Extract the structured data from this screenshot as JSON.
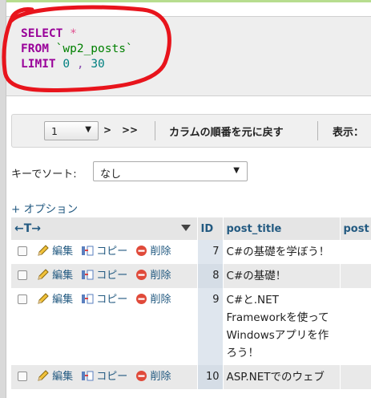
{
  "sql": {
    "line1": {
      "keyword": "SELECT",
      "rest": "*"
    },
    "line2": {
      "keyword": "FROM",
      "rest": "`wp2_posts`"
    },
    "line3": {
      "keyword": "LIMIT",
      "offset": "0",
      "comma": ",",
      "count": "30"
    }
  },
  "nav": {
    "page_value": "1",
    "next_label": ">",
    "last_label": ">>",
    "reset_columns_label": "カラムの順番を元に戻す",
    "display_label": "表示："
  },
  "sort": {
    "label": "キーでソート:",
    "selected": "なし"
  },
  "options_link": "+ オプション",
  "table": {
    "headers": {
      "arrows": "←T→",
      "id": "ID",
      "title": "post_title",
      "next": "post"
    },
    "actions": {
      "edit": "編集",
      "copy": "コピー",
      "delete": "削除"
    },
    "rows": [
      {
        "id": "7",
        "title": "C#の基礎を学ぼう！"
      },
      {
        "id": "8",
        "title": "C#の基礎！"
      },
      {
        "id": "9",
        "title": "C#と.NET Frameworkを使ってWindowsアプリを作ろう！"
      },
      {
        "id": "10",
        "title": "ASP.NETでのウェブ"
      }
    ]
  },
  "colors": {
    "link": "#235a81",
    "keyword": "#990099",
    "annotation": "#e8141c"
  }
}
